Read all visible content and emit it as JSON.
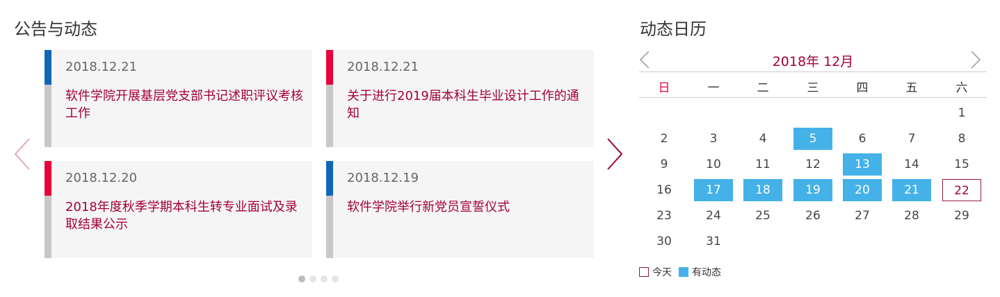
{
  "notices": {
    "title": "公告与动态",
    "cards": [
      {
        "date": "2018.12.21",
        "title": "软件学院开展基层党支部书记述职评议考核工作",
        "accent": "#1066b7"
      },
      {
        "date": "2018.12.21",
        "title": "关于进行2019届本科生毕业设计工作的通知",
        "accent": "#e8003a"
      },
      {
        "date": "2018.12.20",
        "title": "2018年度秋季学期本科生转专业面试及录取结果公示",
        "accent": "#e8003a"
      },
      {
        "date": "2018.12.19",
        "title": "软件学院举行新党员宣誓仪式",
        "accent": "#1066b7"
      }
    ],
    "pages": 4,
    "active_page": 1
  },
  "calendar": {
    "title": "动态日历",
    "month_label": "2018年 12月",
    "weekdays": [
      "日",
      "一",
      "二",
      "三",
      "四",
      "五",
      "六"
    ],
    "weeks": [
      [
        "",
        "",
        "",
        "",
        "",
        "",
        "1"
      ],
      [
        "2",
        "3",
        "4",
        "5",
        "6",
        "7",
        "8"
      ],
      [
        "9",
        "10",
        "11",
        "12",
        "13",
        "14",
        "15"
      ],
      [
        "16",
        "17",
        "18",
        "19",
        "20",
        "21",
        "22"
      ],
      [
        "23",
        "24",
        "25",
        "26",
        "27",
        "28",
        "29"
      ],
      [
        "30",
        "31",
        "",
        "",
        "",
        "",
        ""
      ]
    ],
    "event_days": [
      "5",
      "13",
      "17",
      "18",
      "19",
      "20",
      "21"
    ],
    "today": "22",
    "legend": {
      "today": "今天",
      "event": "有动态"
    }
  },
  "colors": {
    "accent": "#a3003a",
    "event": "#45b1e9",
    "blue": "#1066b7",
    "red": "#e8003a"
  }
}
